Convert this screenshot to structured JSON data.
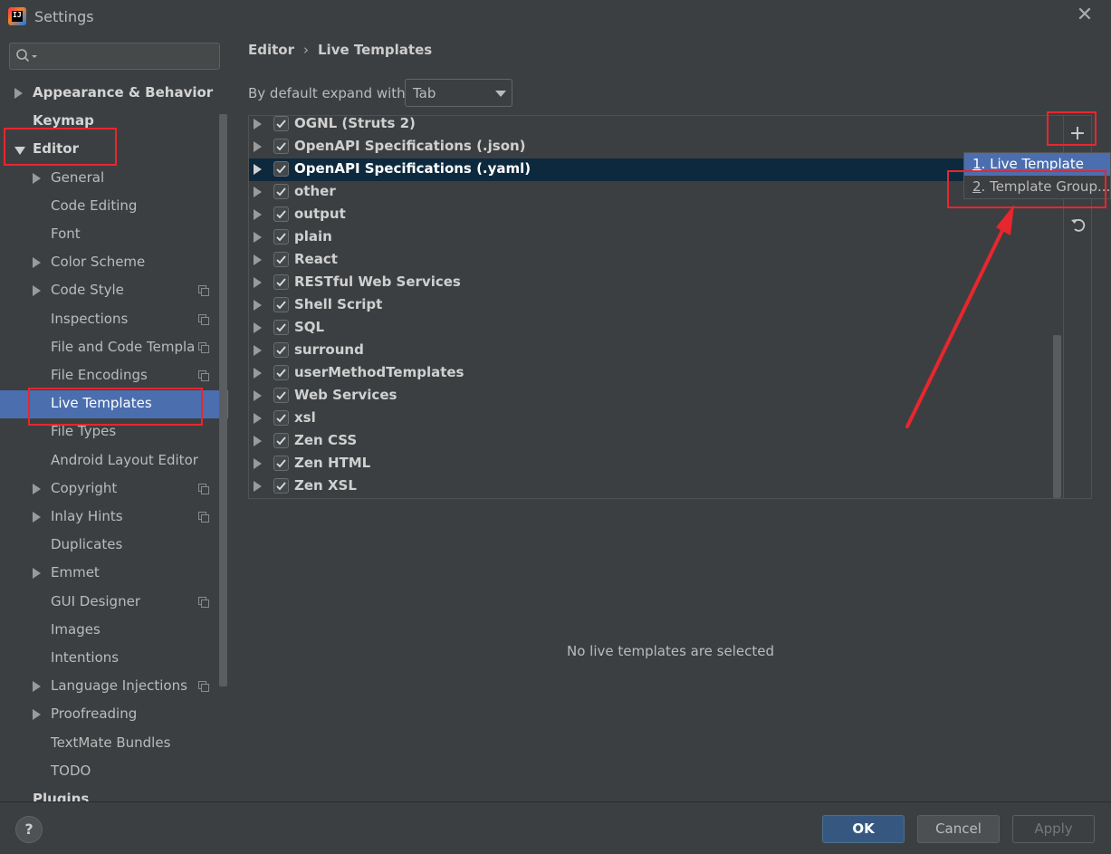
{
  "window": {
    "title": "Settings",
    "close_glyph": "✕",
    "app_icon_text": "IJ"
  },
  "search": {
    "placeholder": "",
    "value": ""
  },
  "sidebar": {
    "items": [
      {
        "label": "Appearance & Behavior",
        "level": 0,
        "expander": "collapsed",
        "bold": true
      },
      {
        "label": "Keymap",
        "level": 0,
        "expander": "none",
        "bold": true
      },
      {
        "label": "Editor",
        "level": 0,
        "expander": "expanded",
        "bold": true
      },
      {
        "label": "General",
        "level": 1,
        "expander": "collapsed"
      },
      {
        "label": "Code Editing",
        "level": 1,
        "expander": "none"
      },
      {
        "label": "Font",
        "level": 1,
        "expander": "none"
      },
      {
        "label": "Color Scheme",
        "level": 1,
        "expander": "collapsed"
      },
      {
        "label": "Code Style",
        "level": 1,
        "expander": "collapsed",
        "project_icon": true
      },
      {
        "label": "Inspections",
        "level": 1,
        "expander": "none",
        "project_icon": true
      },
      {
        "label": "File and Code Templa",
        "level": 1,
        "expander": "none",
        "project_icon": true
      },
      {
        "label": "File Encodings",
        "level": 1,
        "expander": "none",
        "project_icon": true
      },
      {
        "label": "Live Templates",
        "level": 1,
        "expander": "none",
        "selected": true
      },
      {
        "label": "File Types",
        "level": 1,
        "expander": "none"
      },
      {
        "label": "Android Layout Editor",
        "level": 1,
        "expander": "none"
      },
      {
        "label": "Copyright",
        "level": 1,
        "expander": "collapsed",
        "project_icon": true
      },
      {
        "label": "Inlay Hints",
        "level": 1,
        "expander": "collapsed",
        "project_icon": true
      },
      {
        "label": "Duplicates",
        "level": 1,
        "expander": "none"
      },
      {
        "label": "Emmet",
        "level": 1,
        "expander": "collapsed"
      },
      {
        "label": "GUI Designer",
        "level": 1,
        "expander": "none",
        "project_icon": true
      },
      {
        "label": "Images",
        "level": 1,
        "expander": "none"
      },
      {
        "label": "Intentions",
        "level": 1,
        "expander": "none"
      },
      {
        "label": "Language Injections",
        "level": 1,
        "expander": "collapsed",
        "project_icon": true
      },
      {
        "label": "Proofreading",
        "level": 1,
        "expander": "collapsed"
      },
      {
        "label": "TextMate Bundles",
        "level": 1,
        "expander": "none"
      },
      {
        "label": "TODO",
        "level": 1,
        "expander": "none"
      },
      {
        "label": "Plugins",
        "level": 0,
        "expander": "none",
        "bold": true
      }
    ]
  },
  "breadcrumb": {
    "parent": "Editor",
    "separator": "›",
    "current": "Live Templates"
  },
  "expand": {
    "label": "By default expand with",
    "value": "Tab"
  },
  "templates": {
    "groups": [
      {
        "name": "OGNL (Struts 2)",
        "checked": true
      },
      {
        "name": "OpenAPI Specifications (.json)",
        "checked": true
      },
      {
        "name": "OpenAPI Specifications (.yaml)",
        "checked": true,
        "selected": true
      },
      {
        "name": "other",
        "checked": true
      },
      {
        "name": "output",
        "checked": true
      },
      {
        "name": "plain",
        "checked": true
      },
      {
        "name": "React",
        "checked": true
      },
      {
        "name": "RESTful Web Services",
        "checked": true
      },
      {
        "name": "Shell Script",
        "checked": true
      },
      {
        "name": "SQL",
        "checked": true
      },
      {
        "name": "surround",
        "checked": true
      },
      {
        "name": "userMethodTemplates",
        "checked": true
      },
      {
        "name": "Web Services",
        "checked": true
      },
      {
        "name": "xsl",
        "checked": true
      },
      {
        "name": "Zen CSS",
        "checked": true
      },
      {
        "name": "Zen HTML",
        "checked": true
      },
      {
        "name": "Zen XSL",
        "checked": true
      }
    ],
    "empty_message": "No live templates are selected"
  },
  "toolbar": {
    "add_glyph": "+",
    "add_icon": "plus-icon",
    "undo_icon": "undo-icon"
  },
  "popup": {
    "items": [
      {
        "mnemonic": "1",
        "label": ". Live Template",
        "selected": true
      },
      {
        "mnemonic": "2",
        "label": ". Template Group..."
      }
    ]
  },
  "buttons": {
    "ok": "OK",
    "cancel": "Cancel",
    "apply": "Apply",
    "help": "?"
  },
  "colors": {
    "accent": "#4b6eaf",
    "annotation": "#e8262e",
    "background": "#3c3f41",
    "ok_button": "#365880"
  }
}
